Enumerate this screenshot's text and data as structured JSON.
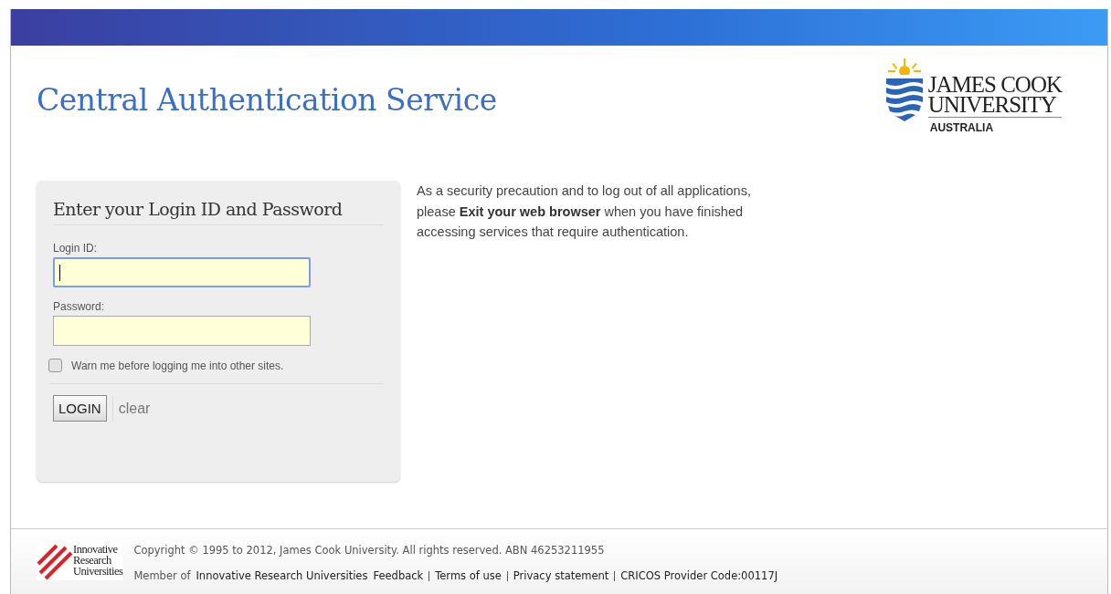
{
  "header": {
    "title": "Central Authentication Service",
    "logo": {
      "line1": "JAMES COOK",
      "line2": "UNIVERSITY",
      "line3": "AUSTRALIA"
    }
  },
  "login": {
    "heading": "Enter your Login ID and Password",
    "fields": [
      {
        "label": "Login ID:",
        "focused": true
      },
      {
        "label": "Password:",
        "focused": false
      }
    ],
    "warn": {
      "label": "Warn me before logging me into other sites.",
      "checked": false
    },
    "submit": "LOGIN",
    "clear": "clear"
  },
  "notice": "As a security precaution and to log out of all applications, please **Exit your web browser** when you have finished accessing services that require authentication.",
  "footer": {
    "logo": [
      "Innovative",
      "Research",
      "Universities"
    ],
    "copyright": "Copyright © 1995 to 2012, James Cook University. All rights reserved. ABN 46253211955",
    "member_prefix": "Member of",
    "links": [
      "Innovative Research Universities",
      "Feedback",
      "Terms of use",
      "Privacy statement",
      "CRICOS Provider Code:00117J"
    ]
  }
}
